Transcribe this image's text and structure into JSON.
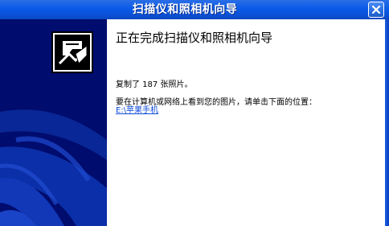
{
  "window": {
    "title": "扫描仪和照相机向导",
    "close_icon": "close-icon"
  },
  "banner": {
    "background_color": "#000c6e",
    "icon": "scanner-camera-wizard-icon"
  },
  "content": {
    "heading": "正在完成扫描仪和照相机向导",
    "copied_text": "复制了 187 张照片。",
    "instruction": "要在计算机或网络上看到您的图片，请单击下面的位置：",
    "location_link": "E:\\苹果手机"
  },
  "colors": {
    "title_bar": "#0a5ae8",
    "link": "#0b49d8"
  }
}
